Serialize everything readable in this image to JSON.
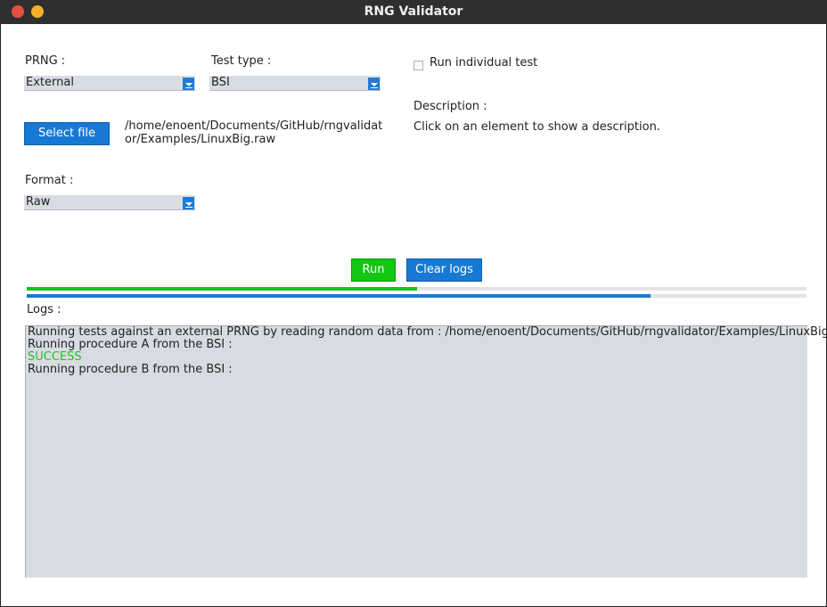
{
  "window": {
    "title": "RNG Validator"
  },
  "prng": {
    "label": "PRNG :",
    "value": "External"
  },
  "test_type": {
    "label": "Test type :",
    "value": "BSI"
  },
  "individual_test": {
    "label": "Run individual test",
    "checked": false
  },
  "file": {
    "button_label": "Select file",
    "path": "/home/enoent/Documents/GitHub/rngvalidator/Examples/LinuxBig.raw"
  },
  "description": {
    "label": "Description :",
    "text": "Click on an element to show a description."
  },
  "format": {
    "label": "Format :",
    "value": "Raw"
  },
  "actions": {
    "run_label": "Run",
    "clear_label": "Clear logs"
  },
  "progress": {
    "overall_fraction": 0.5,
    "current_fraction": 0.8,
    "overall_color": "#16c216",
    "current_color": "#1879d4"
  },
  "logs": {
    "label": "Logs :",
    "lines": [
      {
        "text": "Running tests against an external PRNG by reading random data from : /home/enoent/Documents/GitHub/rngvalidator/Examples/LinuxBig.raw",
        "status": "normal"
      },
      {
        "text": "Running procedure A from the BSI :",
        "status": "normal"
      },
      {
        "text": "SUCCESS",
        "status": "success"
      },
      {
        "text": "Running procedure B from the BSI :",
        "status": "normal"
      }
    ]
  },
  "colors": {
    "accent_blue": "#1879d4",
    "accent_green": "#13c613",
    "titlebar": "#2f2f2f"
  }
}
